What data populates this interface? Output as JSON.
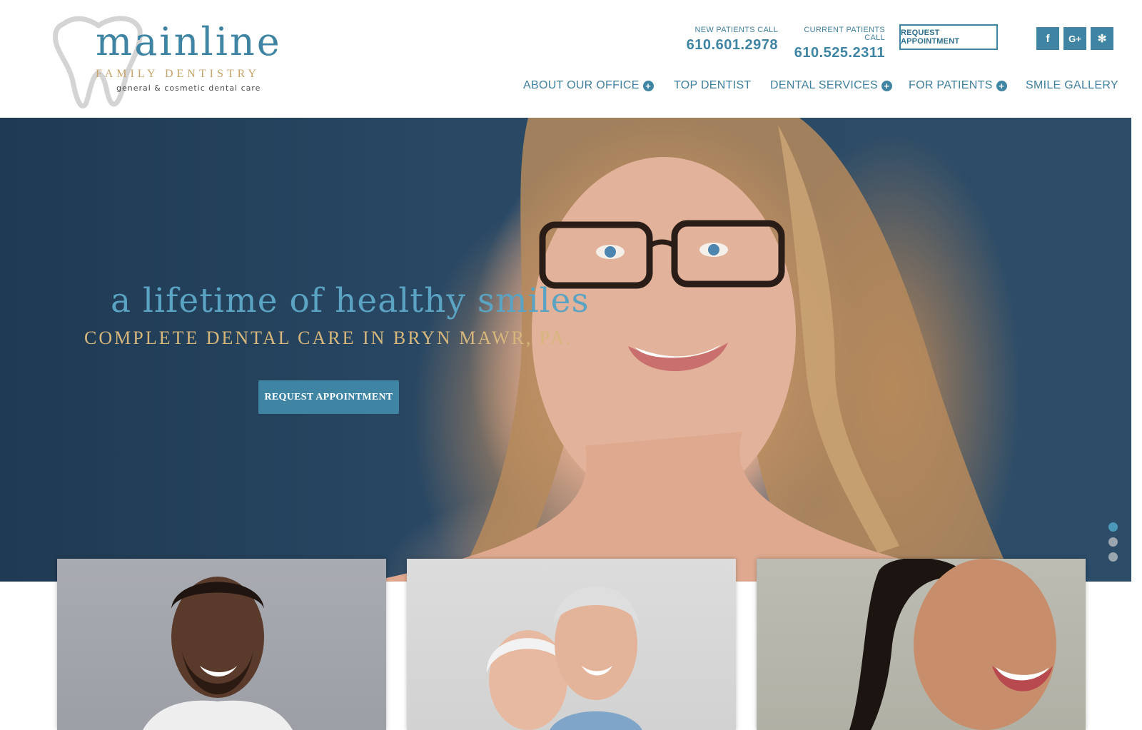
{
  "logo": {
    "name": "mainline",
    "subtitle": "FAMILY DENTISTRY",
    "tagline": "general & cosmetic dental care"
  },
  "contact": {
    "new_patients_label": "NEW PATIENTS CALL",
    "new_patients_phone": "610.601.2978",
    "current_patients_label": "CURRENT PATIENTS CALL",
    "current_patients_phone": "610.525.2311"
  },
  "header": {
    "request_button": "REQUEST APPOINTMENT"
  },
  "social": [
    {
      "icon": "facebook-icon",
      "glyph": "f"
    },
    {
      "icon": "google-plus-icon",
      "glyph": "G+"
    },
    {
      "icon": "yelp-icon",
      "glyph": "✻"
    }
  ],
  "nav": {
    "items": [
      {
        "label": "ABOUT OUR OFFICE",
        "has_submenu": true
      },
      {
        "label": "TOP DENTIST",
        "has_submenu": false
      },
      {
        "label": "DENTAL SERVICES",
        "has_submenu": true
      },
      {
        "label": "FOR PATIENTS",
        "has_submenu": true
      },
      {
        "label": "SMILE GALLERY",
        "has_submenu": false
      }
    ]
  },
  "hero": {
    "headline": "a lifetime of healthy smiles",
    "subheadline": "COMPLETE DENTAL CARE IN BRYN MAWR, PA.",
    "button": "REQUEST APPOINTMENT",
    "slides_total": 3,
    "active_slide": 1
  },
  "colors": {
    "brand_blue": "#3f85a3",
    "gold": "#c7a36a",
    "hero_bg": "#294864"
  }
}
